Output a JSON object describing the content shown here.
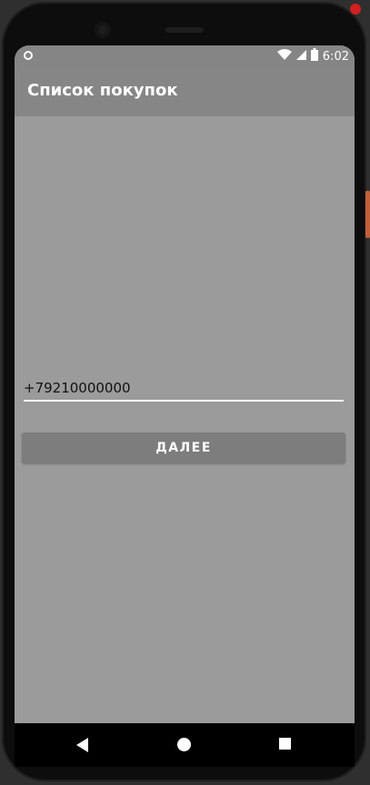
{
  "status_bar": {
    "time": "6:02",
    "icons": [
      "notification-circle-icon",
      "wifi-icon",
      "signal-icon",
      "battery-icon"
    ]
  },
  "app_bar": {
    "title": "Список покупок"
  },
  "form": {
    "phone_value": "+79210000000"
  },
  "actions": {
    "next_label": "ДАЛЕЕ"
  },
  "navigation": {
    "buttons": [
      "back",
      "home",
      "recents"
    ]
  },
  "colors": {
    "screen_background": "#9b9b9b",
    "app_bar": "#868686",
    "button": "#7d7d7d",
    "text_light": "#ffffff"
  }
}
